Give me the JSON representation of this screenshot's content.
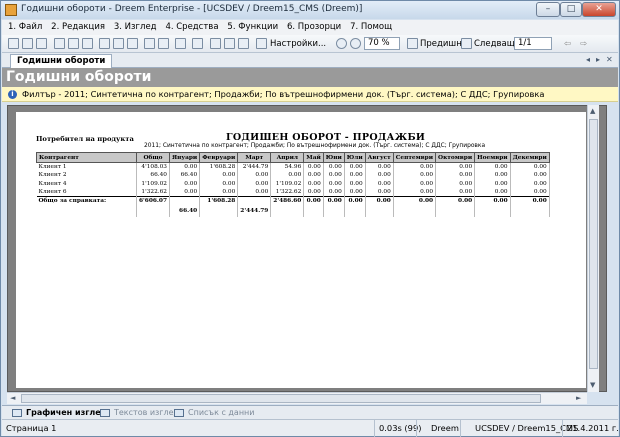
{
  "window": {
    "title": "Годишни обороти - Dreem Enterprise - [UCSDEV / Dreem15_CMS (Dreem)]"
  },
  "menu": [
    "1. Файл",
    "2. Редакция",
    "3. Изглед",
    "4. Средства",
    "5. Функции",
    "6. Прозорци",
    "7. Помощ"
  ],
  "toolbar": {
    "settings_label": "Настройки...",
    "zoom": "70 %",
    "prev_label": "Предишна",
    "next_label": "Следваща",
    "page": "1/1"
  },
  "tab": {
    "label": "Годишни обороти"
  },
  "header": {
    "title": "Годишни обороти"
  },
  "filter": {
    "text": "Филтър - 2011; Синтетична по контрагент; Продажби; По вътрешнофирмени док. (Търг. система); С ДДС; Групировка"
  },
  "report": {
    "left_title": "Потребител на продукта",
    "title": "ГОДИШЕН ОБОРОТ - ПРОДАЖБИ",
    "subtitle": "2011; Синтетична по контрагент; Продажби; По вътрешнофирмени док. (Търг. система); С ДДС; Групировка",
    "columns": [
      "Контрагент",
      "Общо",
      "Януари",
      "Февруари",
      "Март",
      "Април",
      "Май",
      "Юни",
      "Юли",
      "Август",
      "Септември",
      "Октомври",
      "Ноември",
      "Декември"
    ],
    "rows": [
      [
        "Клиент 1",
        "4'108.03",
        "0.00",
        "1'608.28",
        "2'444.79",
        "54.96",
        "0.00",
        "0.00",
        "0.00",
        "0.00",
        "0.00",
        "0.00",
        "0.00",
        "0.00"
      ],
      [
        "Клиент 2",
        "66.40",
        "66.40",
        "0.00",
        "0.00",
        "0.00",
        "0.00",
        "0.00",
        "0.00",
        "0.00",
        "0.00",
        "0.00",
        "0.00",
        "0.00"
      ],
      [
        "Клиент 4",
        "1'109.02",
        "0.00",
        "0.00",
        "0.00",
        "1'109.02",
        "0.00",
        "0.00",
        "0.00",
        "0.00",
        "0.00",
        "0.00",
        "0.00",
        "0.00"
      ],
      [
        "Клиент 6",
        "1'322.62",
        "0.00",
        "0.00",
        "0.00",
        "1'322.62",
        "0.00",
        "0.00",
        "0.00",
        "0.00",
        "0.00",
        "0.00",
        "0.00",
        "0.00"
      ]
    ],
    "total_row": [
      "Общо за справката:",
      "6'606.07",
      "",
      "1'608.28",
      "",
      "2'486.60",
      "0.00",
      "0.00",
      "0.00",
      "0.00",
      "0.00",
      "0.00",
      "0.00",
      "0.00"
    ],
    "total_row2": [
      "",
      "",
      "66.40",
      "",
      "2'444.79",
      "",
      "",
      "",
      "",
      "",
      "",
      "",
      "",
      ""
    ]
  },
  "bottom_tabs": [
    "Графичен изглед",
    "Текстов изглед",
    "Списък с данни"
  ],
  "status": {
    "page": "Страница 1",
    "time": "0.03s (99)",
    "user": "Dreem",
    "db": "UCSDEV / Dreem15_CMS",
    "date": "21.4.2011 г."
  }
}
